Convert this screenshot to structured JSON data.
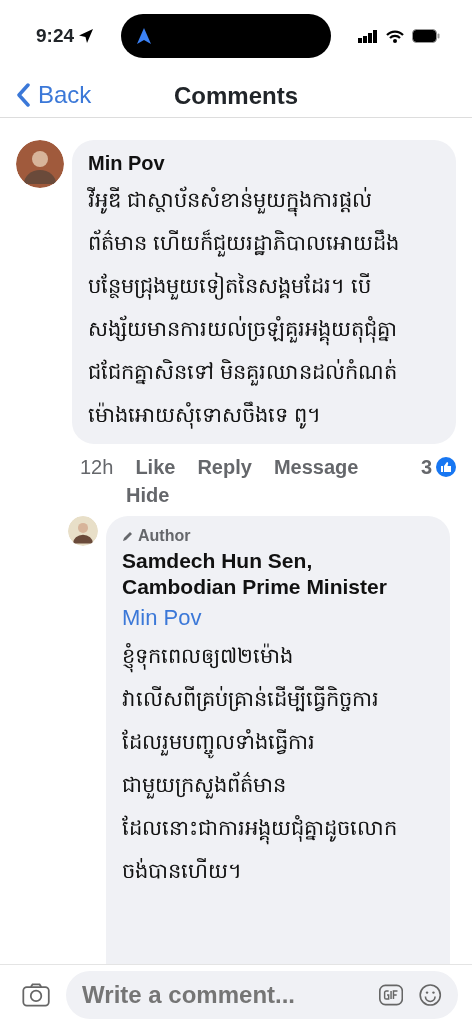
{
  "status_bar": {
    "time": "9:24"
  },
  "header": {
    "back": "Back",
    "title": "Comments"
  },
  "comments": [
    {
      "author": "Min Pov",
      "lines": [
        "វីអូឌី ជាស្ថាប័នសំខាន់មួយក្នុងការផ្តល់",
        "ព័ត៌មាន ហើយក៏ជួយរដ្ឋាភិបាលអោយដឹង",
        "បន្ថែមជ្រុងមួយទៀតនៃសង្គមដែរ។ បើ",
        "សង្ស័យមានការយល់ច្រឡំគួរអង្គុយតុជុំគ្នា",
        "ជជែកគ្នាសិនទៅ មិនគួរឈានដល់កំណត់",
        "ម៉ោងអោយសុំទោសចឹងទេ ពូ។"
      ],
      "time": "12h",
      "actions": [
        "Like",
        "Reply",
        "Message",
        "Hide"
      ],
      "reactions": "3",
      "replies": [
        {
          "badge": "Author",
          "author": "Samdech Hun Sen, Cambodian Prime Minister",
          "mention": "Min Pov",
          "lines": [
            "ខ្ញុំទុកពេលឲ្យ៧២ម៉ោង",
            "វាលើសពីគ្រប់គ្រាន់ដើម្បីធ្វើកិច្ចការ",
            "ដែលរួមបញ្ចូលទាំងធ្វើការ",
            "ជាមួយក្រសួងព័ត៌មាន",
            "ដែលនោះជាការអង្គុយជុំគ្នាដូចលោក",
            "ចង់បានហើយ។"
          ]
        }
      ]
    }
  ],
  "composer": {
    "placeholder": "Write a comment..."
  }
}
